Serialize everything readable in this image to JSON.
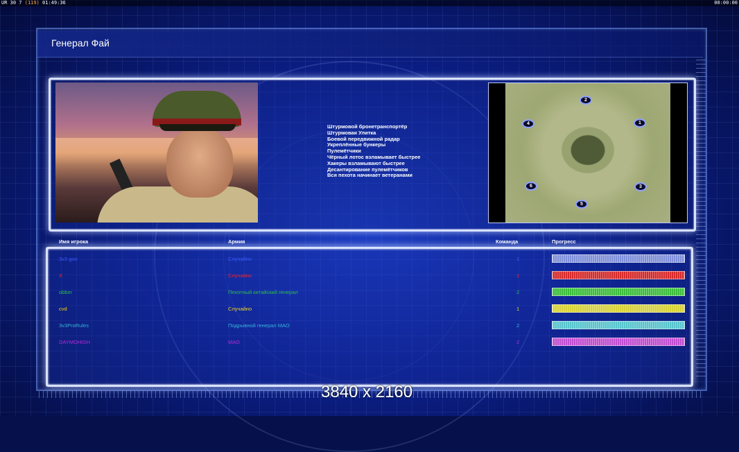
{
  "hud": {
    "left_prefix": "UR 30 7",
    "left_dim": "(119)",
    "left_time": "01:49:36",
    "right_time": "00:00:00"
  },
  "general": {
    "name": "Генерал Фай",
    "bonuses": [
      "Штурмовой бронетранспортёр",
      "Штурмовая Улитка",
      "Боевой передвижной радар",
      "Укреплённые бункеры",
      "Пулемётчики",
      "Чёрный лотос взламывает быстрее",
      "Хакеры взламывают быстрее",
      "Десантирование пулемётчиков",
      "Вся пехота начинает ветеранами"
    ]
  },
  "map": {
    "start_positions": [
      "1",
      "2",
      "3",
      "4",
      "5",
      "6"
    ]
  },
  "columns": {
    "name": "Имя игрока",
    "army": "Армия",
    "team": "Команда",
    "progress": "Прогресс"
  },
  "players": [
    {
      "name": "3v3 goo",
      "army": "Случайно",
      "team": "1",
      "color": "#3a5cff",
      "bar": "#7f8fd8"
    },
    {
      "name": "X",
      "army": "Случайно",
      "team": "1",
      "color": "#ff2020",
      "bar": "#d42a2a"
    },
    {
      "name": "obbm",
      "army": "Пехотный китайский генерал",
      "team": "2",
      "color": "#29c24a",
      "bar": "#3cbd3c"
    },
    {
      "name": "cvd",
      "army": "Случайно",
      "team": "1",
      "color": "#f0d31e",
      "bar": "#d6d03a"
    },
    {
      "name": "3v3ProRules",
      "army": "Подрывной генерал МАО",
      "team": "2",
      "color": "#31b5d8",
      "bar": "#58c4cc"
    },
    {
      "name": "DAYMOHISH",
      "army": "МАО",
      "team": "2",
      "color": "#b52ad4",
      "bar": "#c04ed0"
    }
  ],
  "overlay": {
    "resolution": "3840 x 2160"
  }
}
